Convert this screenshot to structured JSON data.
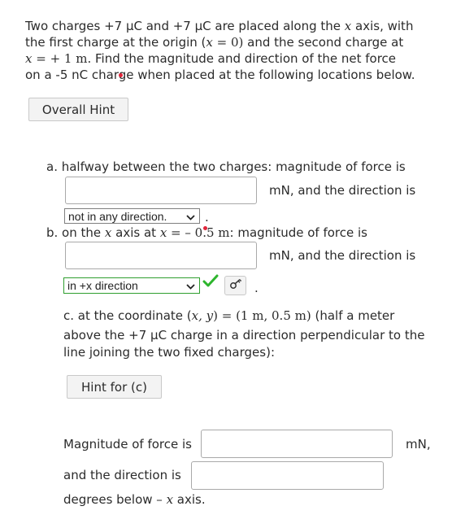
{
  "intro": {
    "line1_a": "Two charges +7 μC and +7 μC are placed along the ",
    "line1_x": "x",
    "line1_b": " axis, with",
    "line2_a": "the first charge at the origin (",
    "line2_x": "x",
    "line2_eq": " = 0)",
    "line2_b": " and the second charge at",
    "line3_x": "x",
    "line3_eq": " =  + 1  m.",
    "line3_b": " Find the magnitude and direction of the net force",
    "line4": "on a -5 nC charge when placed at the following locations below."
  },
  "overall_hint_label": "Overall Hint",
  "part_a": {
    "prompt": "a. halfway between the two charges: magnitude of force is",
    "unit_and_dir": "mN, and the direction is",
    "direction_selected": "not in any direction.",
    "trailing": "."
  },
  "part_b": {
    "prompt_a": "b. on the ",
    "prompt_x": "x",
    "prompt_mid": " axis at ",
    "prompt_x2": "x",
    "prompt_eq": " = ",
    "prompt_val": "– 0.5  m",
    "prompt_b": ": magnitude of force is",
    "unit_and_dir": "mN, and the direction is",
    "direction_selected": "in +x direction",
    "trailing": "."
  },
  "part_c": {
    "line1_a": "c. at the coordinate (",
    "line1_xy": "x, y",
    "line1_eq": ") = (1  m, 0.5  m)",
    "line1_b": " (half a meter",
    "line2": "above the +7 μC charge in a direction perpendicular to the",
    "line3": "line joining the two fixed charges):",
    "hint_label": "Hint for (c)",
    "magnitude_label": "Magnitude of force is",
    "unit": "mN,",
    "direction_label": "and the direction is",
    "degrees_a": "degrees below ",
    "degrees_minus": "– ",
    "degrees_x": "x",
    "degrees_b": " axis."
  },
  "colors": {
    "correct_check": "#2db52d",
    "select_correct_border": "#2f9e2f"
  },
  "icons": [
    "chevron-down-icon",
    "checkmark-icon",
    "key-icon",
    "cursor-dot-icon"
  ]
}
